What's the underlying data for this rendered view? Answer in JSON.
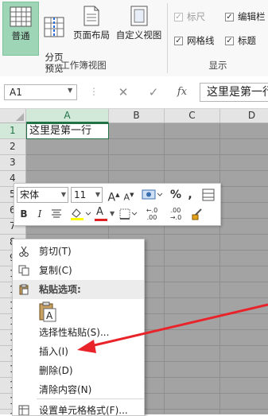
{
  "ribbon": {
    "buttons": [
      {
        "label": "普通"
      },
      {
        "label": "分页\n预览"
      },
      {
        "label": "页面布局"
      },
      {
        "label": "自定义视图"
      }
    ],
    "group_workbook_views": "工作簿视图",
    "group_show": "显示",
    "checks": [
      {
        "label": "标尺",
        "checked": true,
        "disabled": true
      },
      {
        "label": "编辑栏",
        "checked": true,
        "disabled": false
      },
      {
        "label": "网格线",
        "checked": true,
        "disabled": false
      },
      {
        "label": "标题",
        "checked": true,
        "disabled": false
      }
    ]
  },
  "formula_bar": {
    "name_box": "A1",
    "fx_label": "fx",
    "content": "这里是第一行"
  },
  "sheet": {
    "columns": [
      "A",
      "B",
      "C",
      "D"
    ],
    "rows": [
      "1",
      "2",
      "3",
      "4",
      "5",
      "6",
      "7",
      "8",
      "9",
      "1",
      "1",
      "1",
      "1",
      "1",
      "1",
      "1",
      "1",
      "1",
      "1"
    ],
    "a1_value": "这里是第一行"
  },
  "mini_toolbar": {
    "font": "宋体",
    "size": "11",
    "grow_font": "A",
    "shrink_font": "A",
    "percent": "%",
    "bold": "B",
    "italic": "I",
    "font_color_glyph": "A",
    "inc_decimal": "←.0 .00",
    "dec_decimal": ".00 →.0",
    "colors": {
      "highlight": "#ffff00",
      "font": "#e02020"
    }
  },
  "context_menu": {
    "items": [
      {
        "label": "剪切(T)",
        "key": "T"
      },
      {
        "label": "复制(C)",
        "key": "C"
      },
      {
        "label": "粘贴选项:",
        "header": true
      },
      {
        "label": "选择性粘贴(S)...",
        "key": "S"
      },
      {
        "label": "插入(I)",
        "key": "I"
      },
      {
        "label": "删除(D)",
        "key": "D"
      },
      {
        "label": "清除内容(N)",
        "key": "N"
      },
      {
        "label": "设置单元格格式(F)...",
        "key": "F"
      }
    ]
  },
  "colors": {
    "accent": "#217346",
    "selected_button": "#9fd5b7",
    "annotation_arrow": "#e8242a"
  }
}
